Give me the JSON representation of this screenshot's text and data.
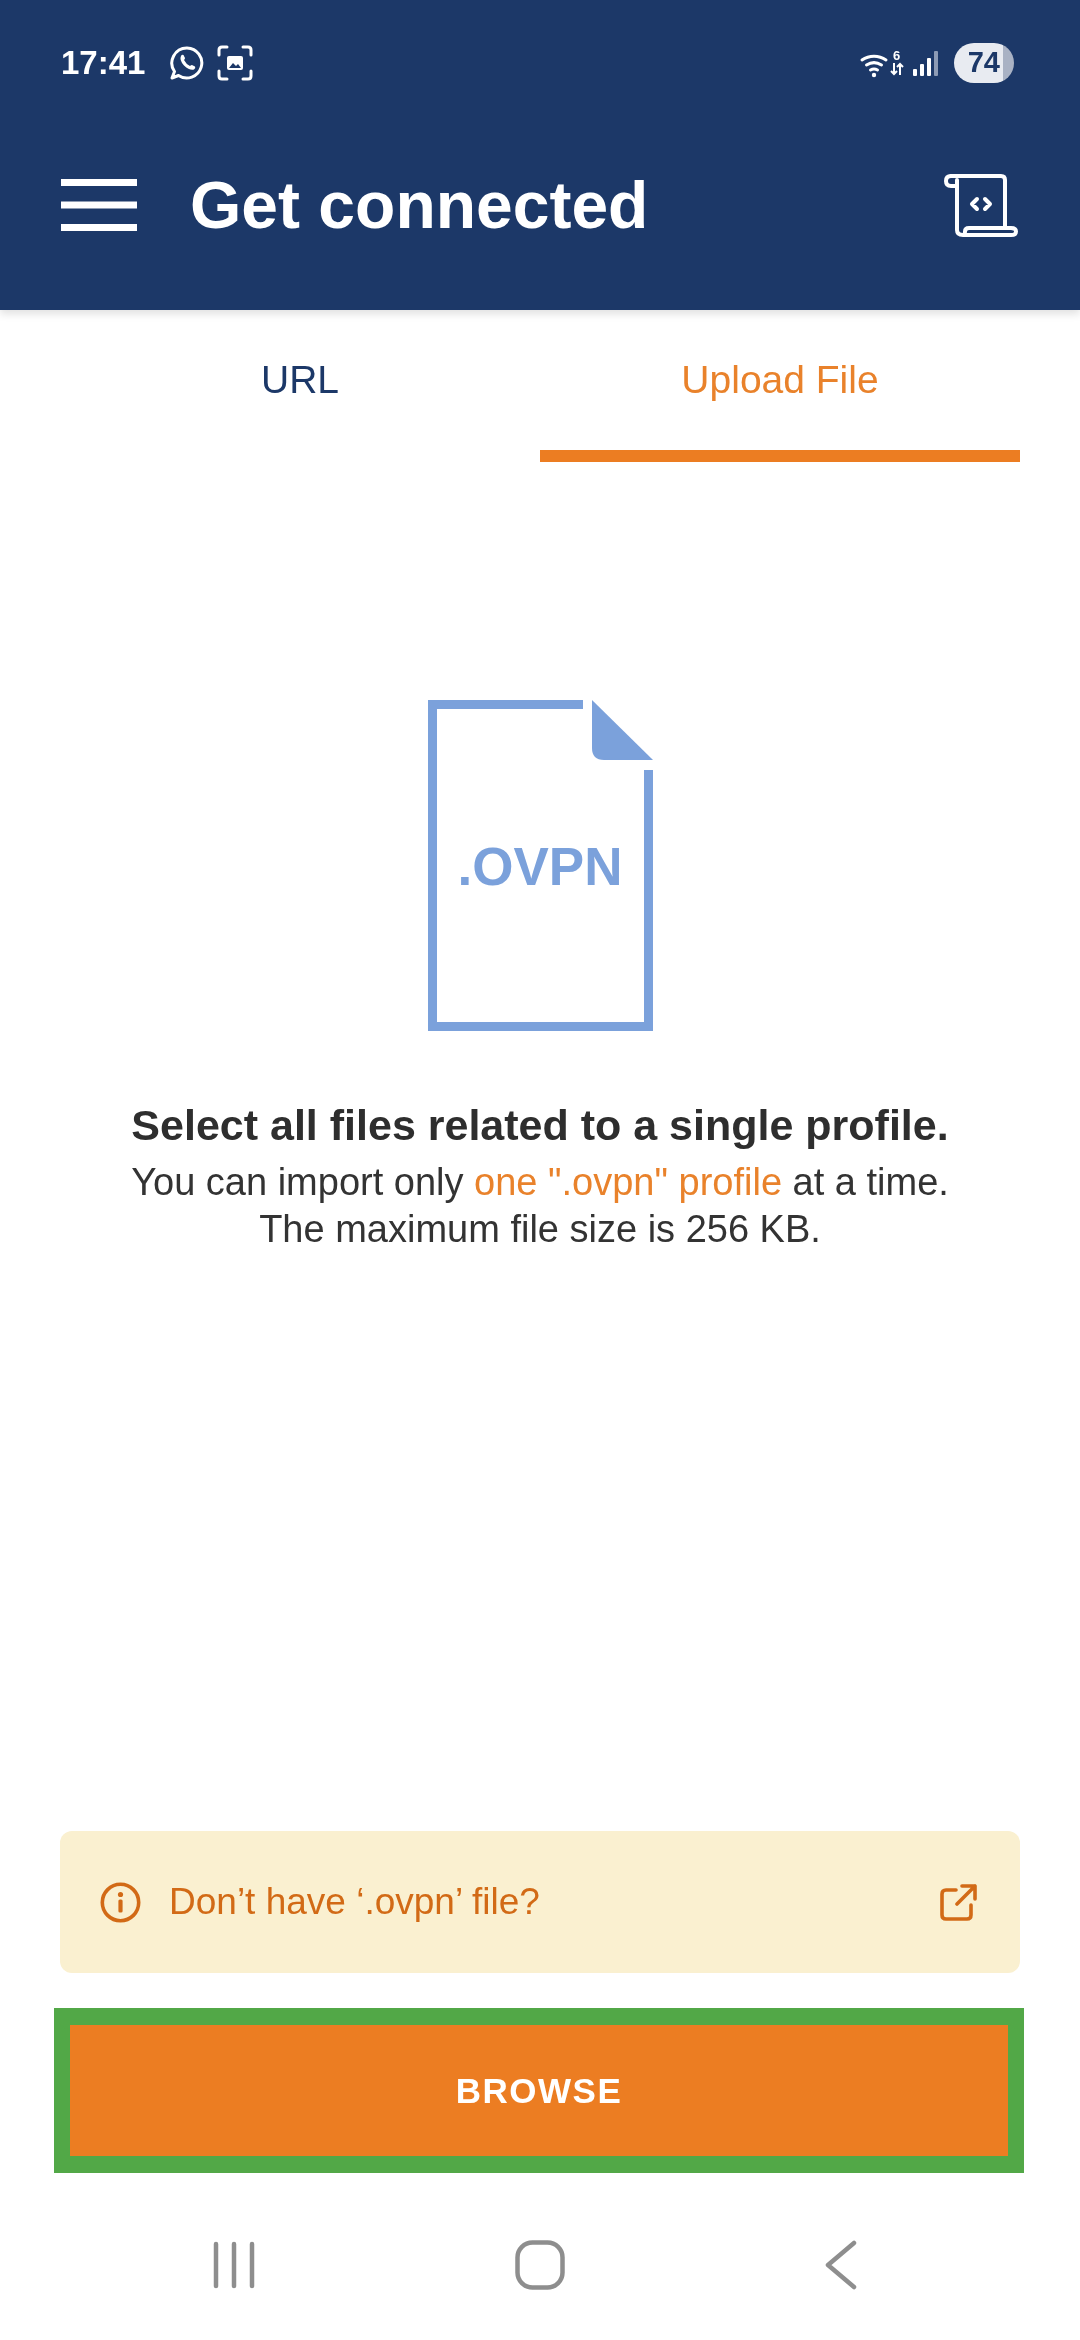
{
  "status_bar": {
    "time": "17:41",
    "wifi_label": "6",
    "battery": "74"
  },
  "app_bar": {
    "title": "Get connected"
  },
  "tabs": [
    {
      "label": "URL",
      "selected": false
    },
    {
      "label": "Upload File",
      "selected": true
    }
  ],
  "file_graphic": {
    "label": ".OVPN"
  },
  "instructions": {
    "heading": "Select all files related to a single profile.",
    "note_before": "You can import only ",
    "note_link": "one \".ovpn\" profile",
    "note_after": " at a time.",
    "size_limit": "The maximum file size is 256 KB."
  },
  "help_banner": {
    "text": "Don’t have ‘.ovpn’ file?"
  },
  "browse_button": {
    "label": "BROWSE",
    "highlighted": true
  }
}
